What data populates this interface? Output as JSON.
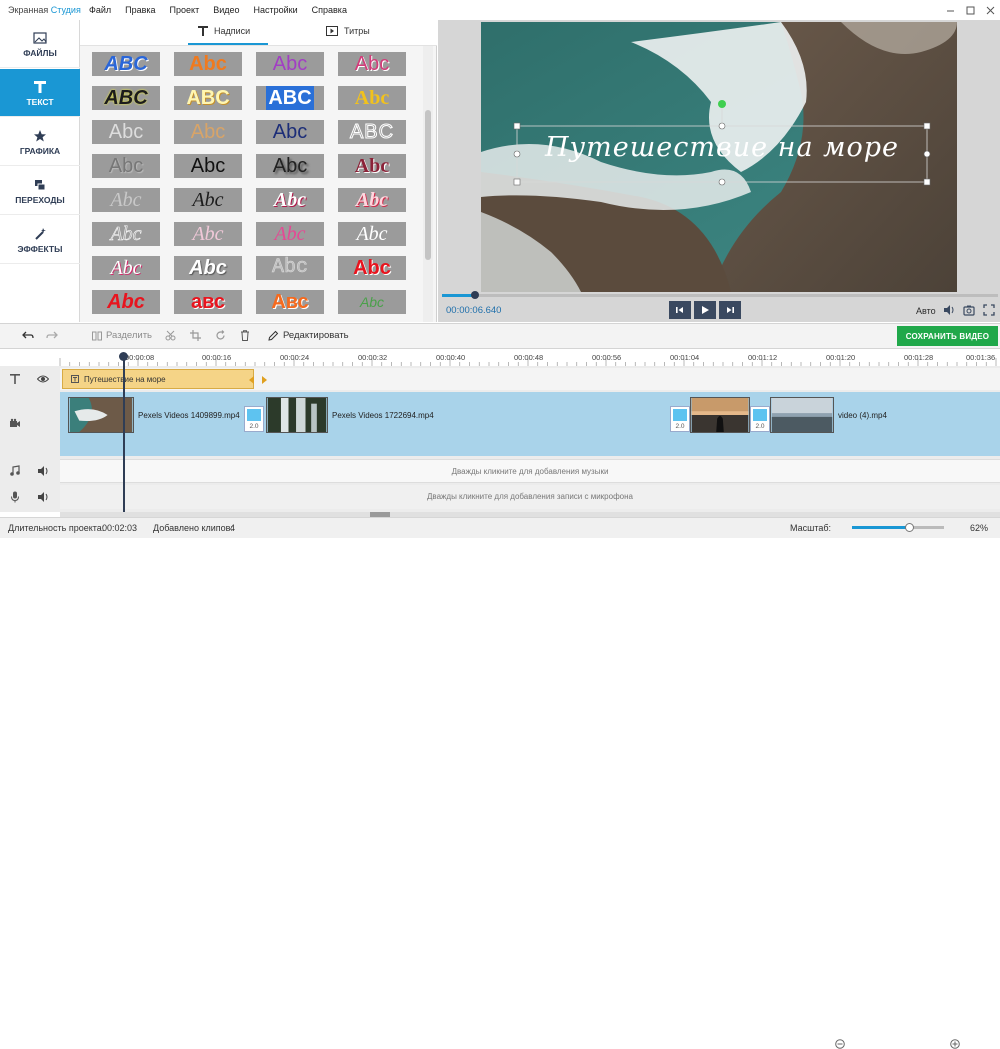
{
  "app": {
    "name_part1": "Экранная ",
    "name_part2": "Студия"
  },
  "menu": [
    "Файл",
    "Правка",
    "Проект",
    "Видео",
    "Настройки",
    "Справка"
  ],
  "nav": [
    {
      "label": "ФАЙЛЫ",
      "icon": "image-icon",
      "active": false
    },
    {
      "label": "ТЕКСТ",
      "icon": "text-t-icon",
      "active": true
    },
    {
      "label": "ГРАФИКА",
      "icon": "star-icon",
      "active": false
    },
    {
      "label": "ПЕРЕХОДЫ",
      "icon": "transition-icon",
      "active": false
    },
    {
      "label": "ЭФФЕКТЫ",
      "icon": "magic-wand-icon",
      "active": false
    }
  ],
  "panel_tabs": {
    "captions": "Надписи",
    "titles": "Титры"
  },
  "text_styles": [
    [
      "ABC",
      "Abc",
      "Abc",
      "Abc"
    ],
    [
      "ABC",
      "ABC",
      "ABC",
      "Abc"
    ],
    [
      "Abc",
      "Abc",
      "Abc",
      "ABC"
    ],
    [
      "Abc",
      "Abc",
      "Abc",
      "Abc"
    ],
    [
      "Abc",
      "Abc",
      "Abc",
      "Abc"
    ],
    [
      "Abc",
      "Abc",
      "Abc",
      "Abc"
    ],
    [
      "Abc",
      "Abc",
      "Abc",
      "Abc"
    ],
    [
      "Abc",
      "авс",
      "Авс",
      "Abc"
    ]
  ],
  "preview": {
    "overlay_text": "Путешествие на море",
    "time": "00:00:06.640",
    "progress": 0.06,
    "auto_label": "Авто"
  },
  "toolbar": {
    "split": "Разделить",
    "edit": "Редактировать",
    "save": "СОХРАНИТЬ ВИДЕО"
  },
  "ruler": [
    "00:00:08",
    "00:00:16",
    "00:00:24",
    "00:00:32",
    "00:00:40",
    "00:00:48",
    "00:00:56",
    "00:01:04",
    "00:01:12",
    "00:01:20",
    "00:01:28",
    "00:01:36"
  ],
  "timeline": {
    "text_clip": "Путешествие на море",
    "clips": [
      {
        "label": "Pexels Videos 1409899.mp4"
      },
      {
        "label": "Pexels Videos 1722694.mp4"
      },
      {
        "label": "video (4).mp4"
      }
    ],
    "transition_label": "2.0",
    "music_hint": "Дважды кликните для добавления музыки",
    "mic_hint": "Дважды кликните для добавления записи с микрофона"
  },
  "status": {
    "duration_label": "Длительность проекта:",
    "duration": "00:02:03",
    "clips_label": "Добавлено клипов:",
    "clips_count": "4",
    "zoom_label": "Масштаб:",
    "zoom_percent": "62%",
    "zoom_value": 0.62
  },
  "colors": {
    "accent": "#1a97d4",
    "save": "#20a84a",
    "clip_text": "#f5d487",
    "video_track": "#a9d3ea"
  }
}
